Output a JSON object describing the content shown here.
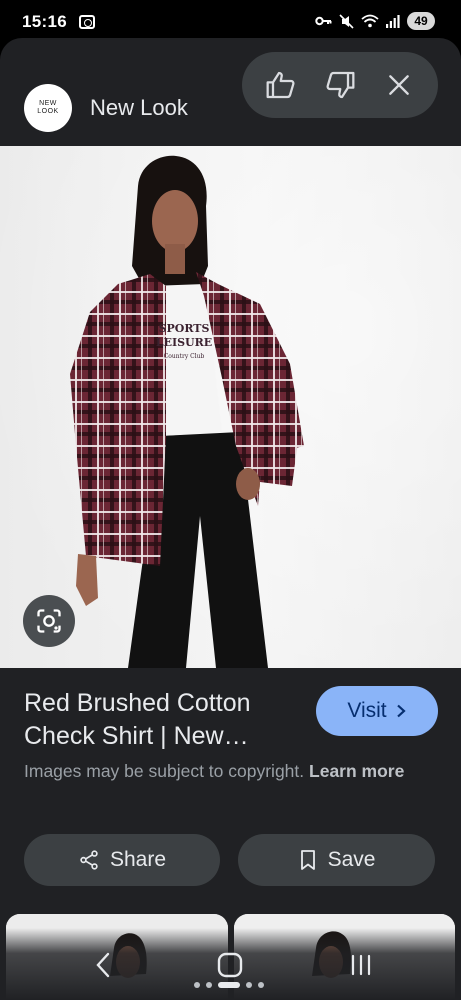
{
  "status_bar": {
    "time": "15:16",
    "battery": "49",
    "icons": [
      "screen-record-icon",
      "vpn-key-icon",
      "mute-icon",
      "wifi-icon",
      "signal-icon"
    ]
  },
  "source": {
    "logo_line1": "NEW",
    "logo_line2": "LOOK",
    "name": "New Look"
  },
  "feedback": {
    "icons": [
      "thumbs-up-icon",
      "thumbs-down-icon",
      "close-icon"
    ]
  },
  "product": {
    "title": "Red Brushed Cotton Check Shirt | New…",
    "tee_print_line1": "SPORTS",
    "tee_print_line2": "LEISURE",
    "tee_print_line3": "Country Club",
    "image_colors": {
      "shirt": "#6b2634",
      "trousers": "#111111",
      "backdrop": "#efefef"
    }
  },
  "visit": {
    "label": "Visit",
    "color": "#8ab4f8"
  },
  "copyright": {
    "text": "Images may be subject to copyright.",
    "link": "Learn more"
  },
  "actions": {
    "share_label": "Share",
    "save_label": "Save"
  },
  "nav": {
    "icons": [
      "back-icon",
      "home-icon",
      "recents-icon"
    ]
  }
}
